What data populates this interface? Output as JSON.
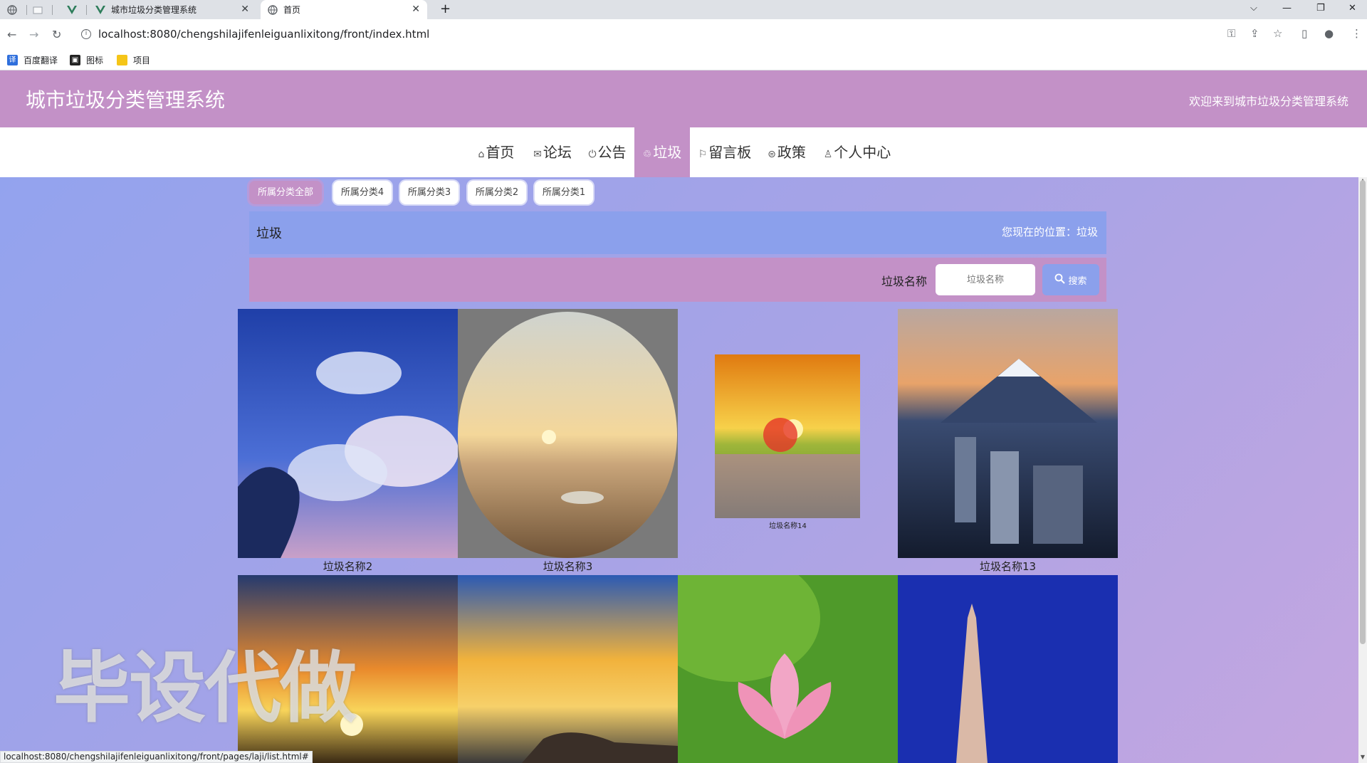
{
  "browser": {
    "tabs": [
      {
        "label": ""
      },
      {
        "label": ""
      },
      {
        "label": ""
      },
      {
        "label": "城市垃圾分类管理系统"
      },
      {
        "label": "首页"
      }
    ],
    "url": "localhost:8080/chengshilajifenleiguanlixitong/front/index.html",
    "bookmarks": [
      "百度翻译",
      "图标",
      "项目"
    ],
    "status_url": "localhost:8080/chengshilajifenleiguanlixitong/front/pages/laji/list.html#"
  },
  "header": {
    "title": "城市垃圾分类管理系统",
    "welcome": "欢迎来到城市垃圾分类管理系统"
  },
  "menu": [
    {
      "label": "首页",
      "icon": "home-icon",
      "glyph": "⌂"
    },
    {
      "label": "论坛",
      "icon": "mail-icon",
      "glyph": "✉"
    },
    {
      "label": "公告",
      "icon": "power-icon",
      "glyph": "⏻"
    },
    {
      "label": "垃圾",
      "icon": "recycle-icon",
      "glyph": "♲"
    },
    {
      "label": "留言板",
      "icon": "flag-icon",
      "glyph": "⚐"
    },
    {
      "label": "政策",
      "icon": "gavel-icon",
      "glyph": "⊜"
    },
    {
      "label": "个人中心",
      "icon": "user-icon",
      "glyph": "♙"
    }
  ],
  "categories": [
    "所属分类全部",
    "所属分类4",
    "所属分类3",
    "所属分类2",
    "所属分类1"
  ],
  "breadcrumb": {
    "title": "垃圾",
    "location": "您现在的位置：垃圾"
  },
  "search": {
    "label": "垃圾名称",
    "placeholder": "垃圾名称",
    "button": "搜索"
  },
  "items": [
    {
      "name": "垃圾名称2",
      "image": "sky-clouds"
    },
    {
      "name": "垃圾名称3",
      "image": "desert-sunset"
    },
    {
      "name": "垃圾名称14",
      "image": "sunset-flowers"
    },
    {
      "name": "垃圾名称13",
      "image": "city-mount-fuji"
    },
    {
      "name": "",
      "image": "road-sunset"
    },
    {
      "name": "",
      "image": "sea-rainbow"
    },
    {
      "name": "",
      "image": "lotus"
    },
    {
      "name": "",
      "image": "eiffel-tower"
    }
  ],
  "watermark": "毕设代做",
  "colors": {
    "brand": "#c391c7",
    "accent": "#8ba0ec"
  }
}
